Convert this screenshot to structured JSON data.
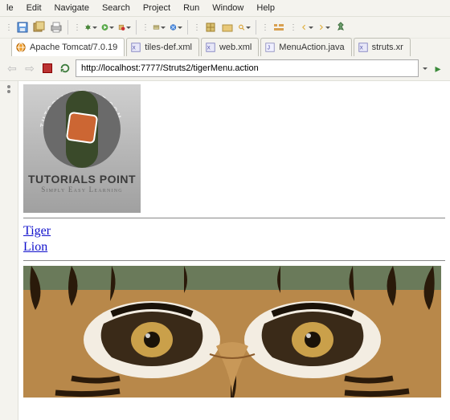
{
  "menu": {
    "items": [
      "le",
      "Edit",
      "Navigate",
      "Search",
      "Project",
      "Run",
      "Window",
      "Help"
    ]
  },
  "tabs": [
    {
      "icon": "globe",
      "label": "Apache Tomcat/7.0.19"
    },
    {
      "icon": "xml",
      "label": "tiles-def.xml"
    },
    {
      "icon": "xml",
      "label": "web.xml"
    },
    {
      "icon": "java",
      "label": "MenuAction.java"
    },
    {
      "icon": "xml",
      "label": "struts.xr"
    }
  ],
  "url": "http://localhost:7777/Struts2/tigerMenu.action",
  "logo": {
    "arc": "TUTORIALSPOINT.COM",
    "line1": "TUTORIALS POINT",
    "line2": "Simply Easy Learning"
  },
  "links": [
    {
      "label": "Tiger"
    },
    {
      "label": "Lion"
    }
  ]
}
